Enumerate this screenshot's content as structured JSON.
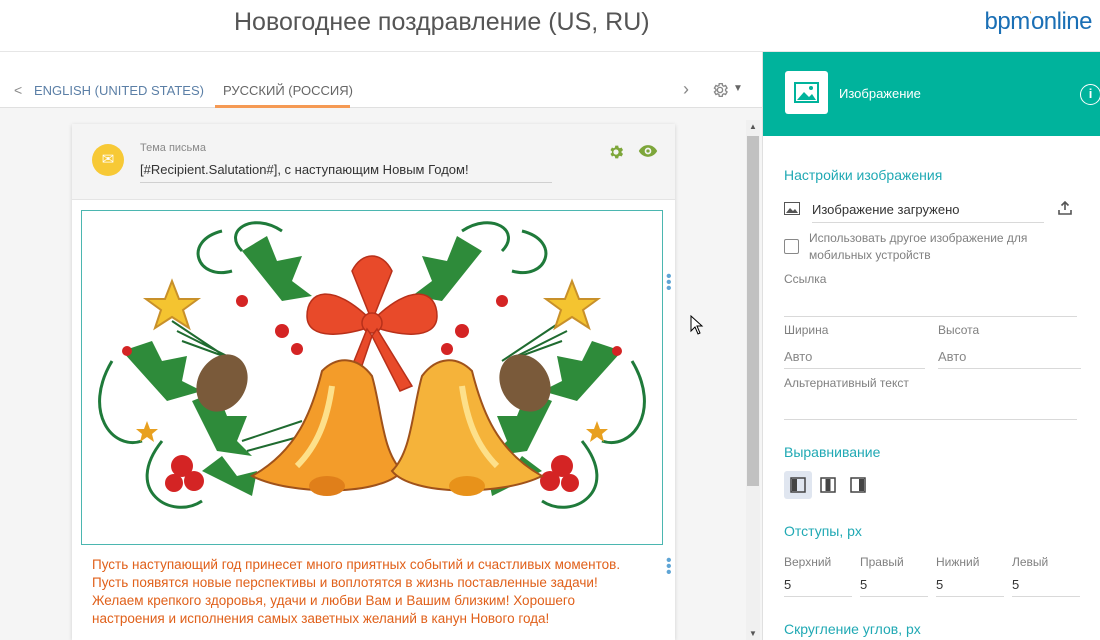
{
  "header": {
    "title": "Новогоднее поздравление (US, RU)",
    "logo_main": "bpm",
    "logo_sup": "'",
    "logo_rest": "online"
  },
  "tabs": {
    "back_arrow": "<",
    "items": [
      {
        "label": "ENGLISH (UNITED STATES)",
        "active": false
      },
      {
        "label": "РУССКИЙ (РОССИЯ)",
        "active": true
      }
    ],
    "next_arrow": "›",
    "settings_icon": "gear-icon"
  },
  "email": {
    "subject_label": "Тема письма",
    "subject_value": "[#Recipient.Salutation#], с наступающим Новым Годом!",
    "greeting_lines": [
      "Пусть наступающий год принесет много приятных событий и счастливых моментов.",
      "Пусть появятся новые перспективы и воплотятся в жизнь поставленные задачи!",
      "Желаем крепкого здоровья, удачи и любви Вам и Вашим близким! Хорошего",
      "настроения и исполнения самых заветных желаний в канун Нового года!"
    ],
    "greeting_color": "#e0601a"
  },
  "panel": {
    "header_title": "Изображение",
    "header_color": "#00b39c",
    "image_settings_title": "Настройки изображения",
    "image_status": "Изображение загружено",
    "mobile_checkbox_label_1": "Использовать другое изображение для",
    "mobile_checkbox_label_2": "мобильных устройств",
    "link_label": "Ссылка",
    "width_label": "Ширина",
    "width_value": "Авто",
    "height_label": "Высота",
    "height_value": "Авто",
    "alt_label": "Альтернативный текст",
    "alignment_title": "Выравнивание",
    "padding_title": "Отступы, px",
    "padding": [
      {
        "label": "Верхний",
        "value": "5"
      },
      {
        "label": "Правый",
        "value": "5"
      },
      {
        "label": "Нижний",
        "value": "5"
      },
      {
        "label": "Левый",
        "value": "5"
      }
    ],
    "rounding_title": "Скругление углов, px"
  }
}
